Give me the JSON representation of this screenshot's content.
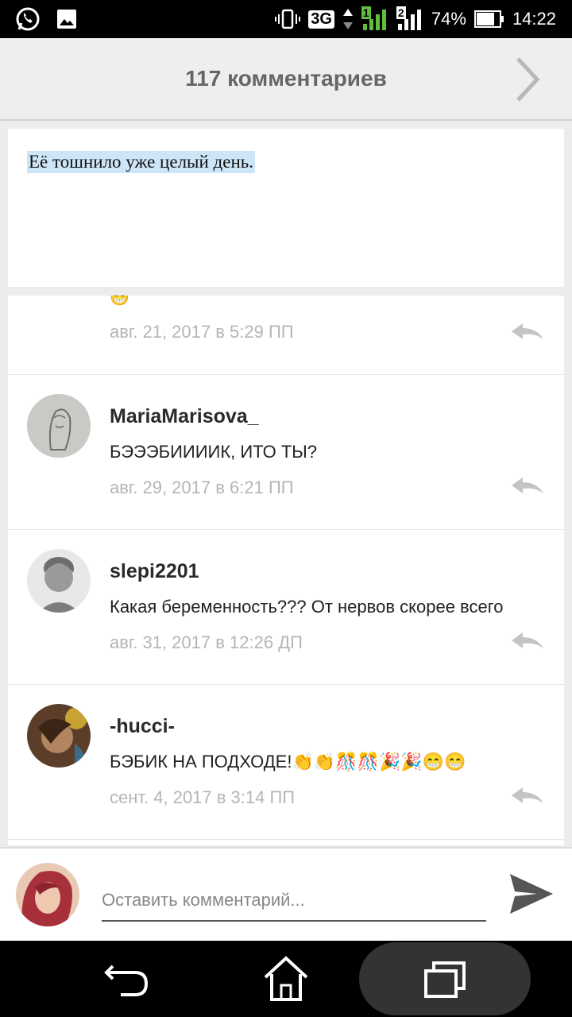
{
  "status_bar": {
    "left_icons": [
      "whatsapp-icon",
      "image-icon"
    ],
    "network": "3G",
    "sim1": "1",
    "sim2": "2",
    "battery": "74%",
    "time": "14:22"
  },
  "header": {
    "title": "117 комментариев",
    "next_icon": "chevron-right-icon"
  },
  "post": {
    "text": "Её тошнило уже целый день."
  },
  "comments": [
    {
      "author": "",
      "text": "😁",
      "date": "авг. 21, 2017 в 5:29 ПП"
    },
    {
      "author": "MariaMarisova_",
      "text": "БЭЭЭБИИИИК, ИТО ТЫ?",
      "date": "авг. 29, 2017 в 6:21 ПП"
    },
    {
      "author": "slepi2201",
      "text": "Какая беременность??? От нервов скорее всего",
      "date": "авг. 31, 2017 в 12:26 ДП"
    },
    {
      "author": "-hucci-",
      "text": "БЭБИК НА ПОДХОДЕ!👏👏🎊🎊🎉🎉😁😁",
      "date": "сент. 4, 2017 в 3:14 ПП"
    }
  ],
  "composer": {
    "placeholder": "Оставить комментарий..."
  },
  "colors": {
    "accent_highlight": "#cde6f7",
    "date_text": "#b5b5b5",
    "title_text": "#666666"
  }
}
